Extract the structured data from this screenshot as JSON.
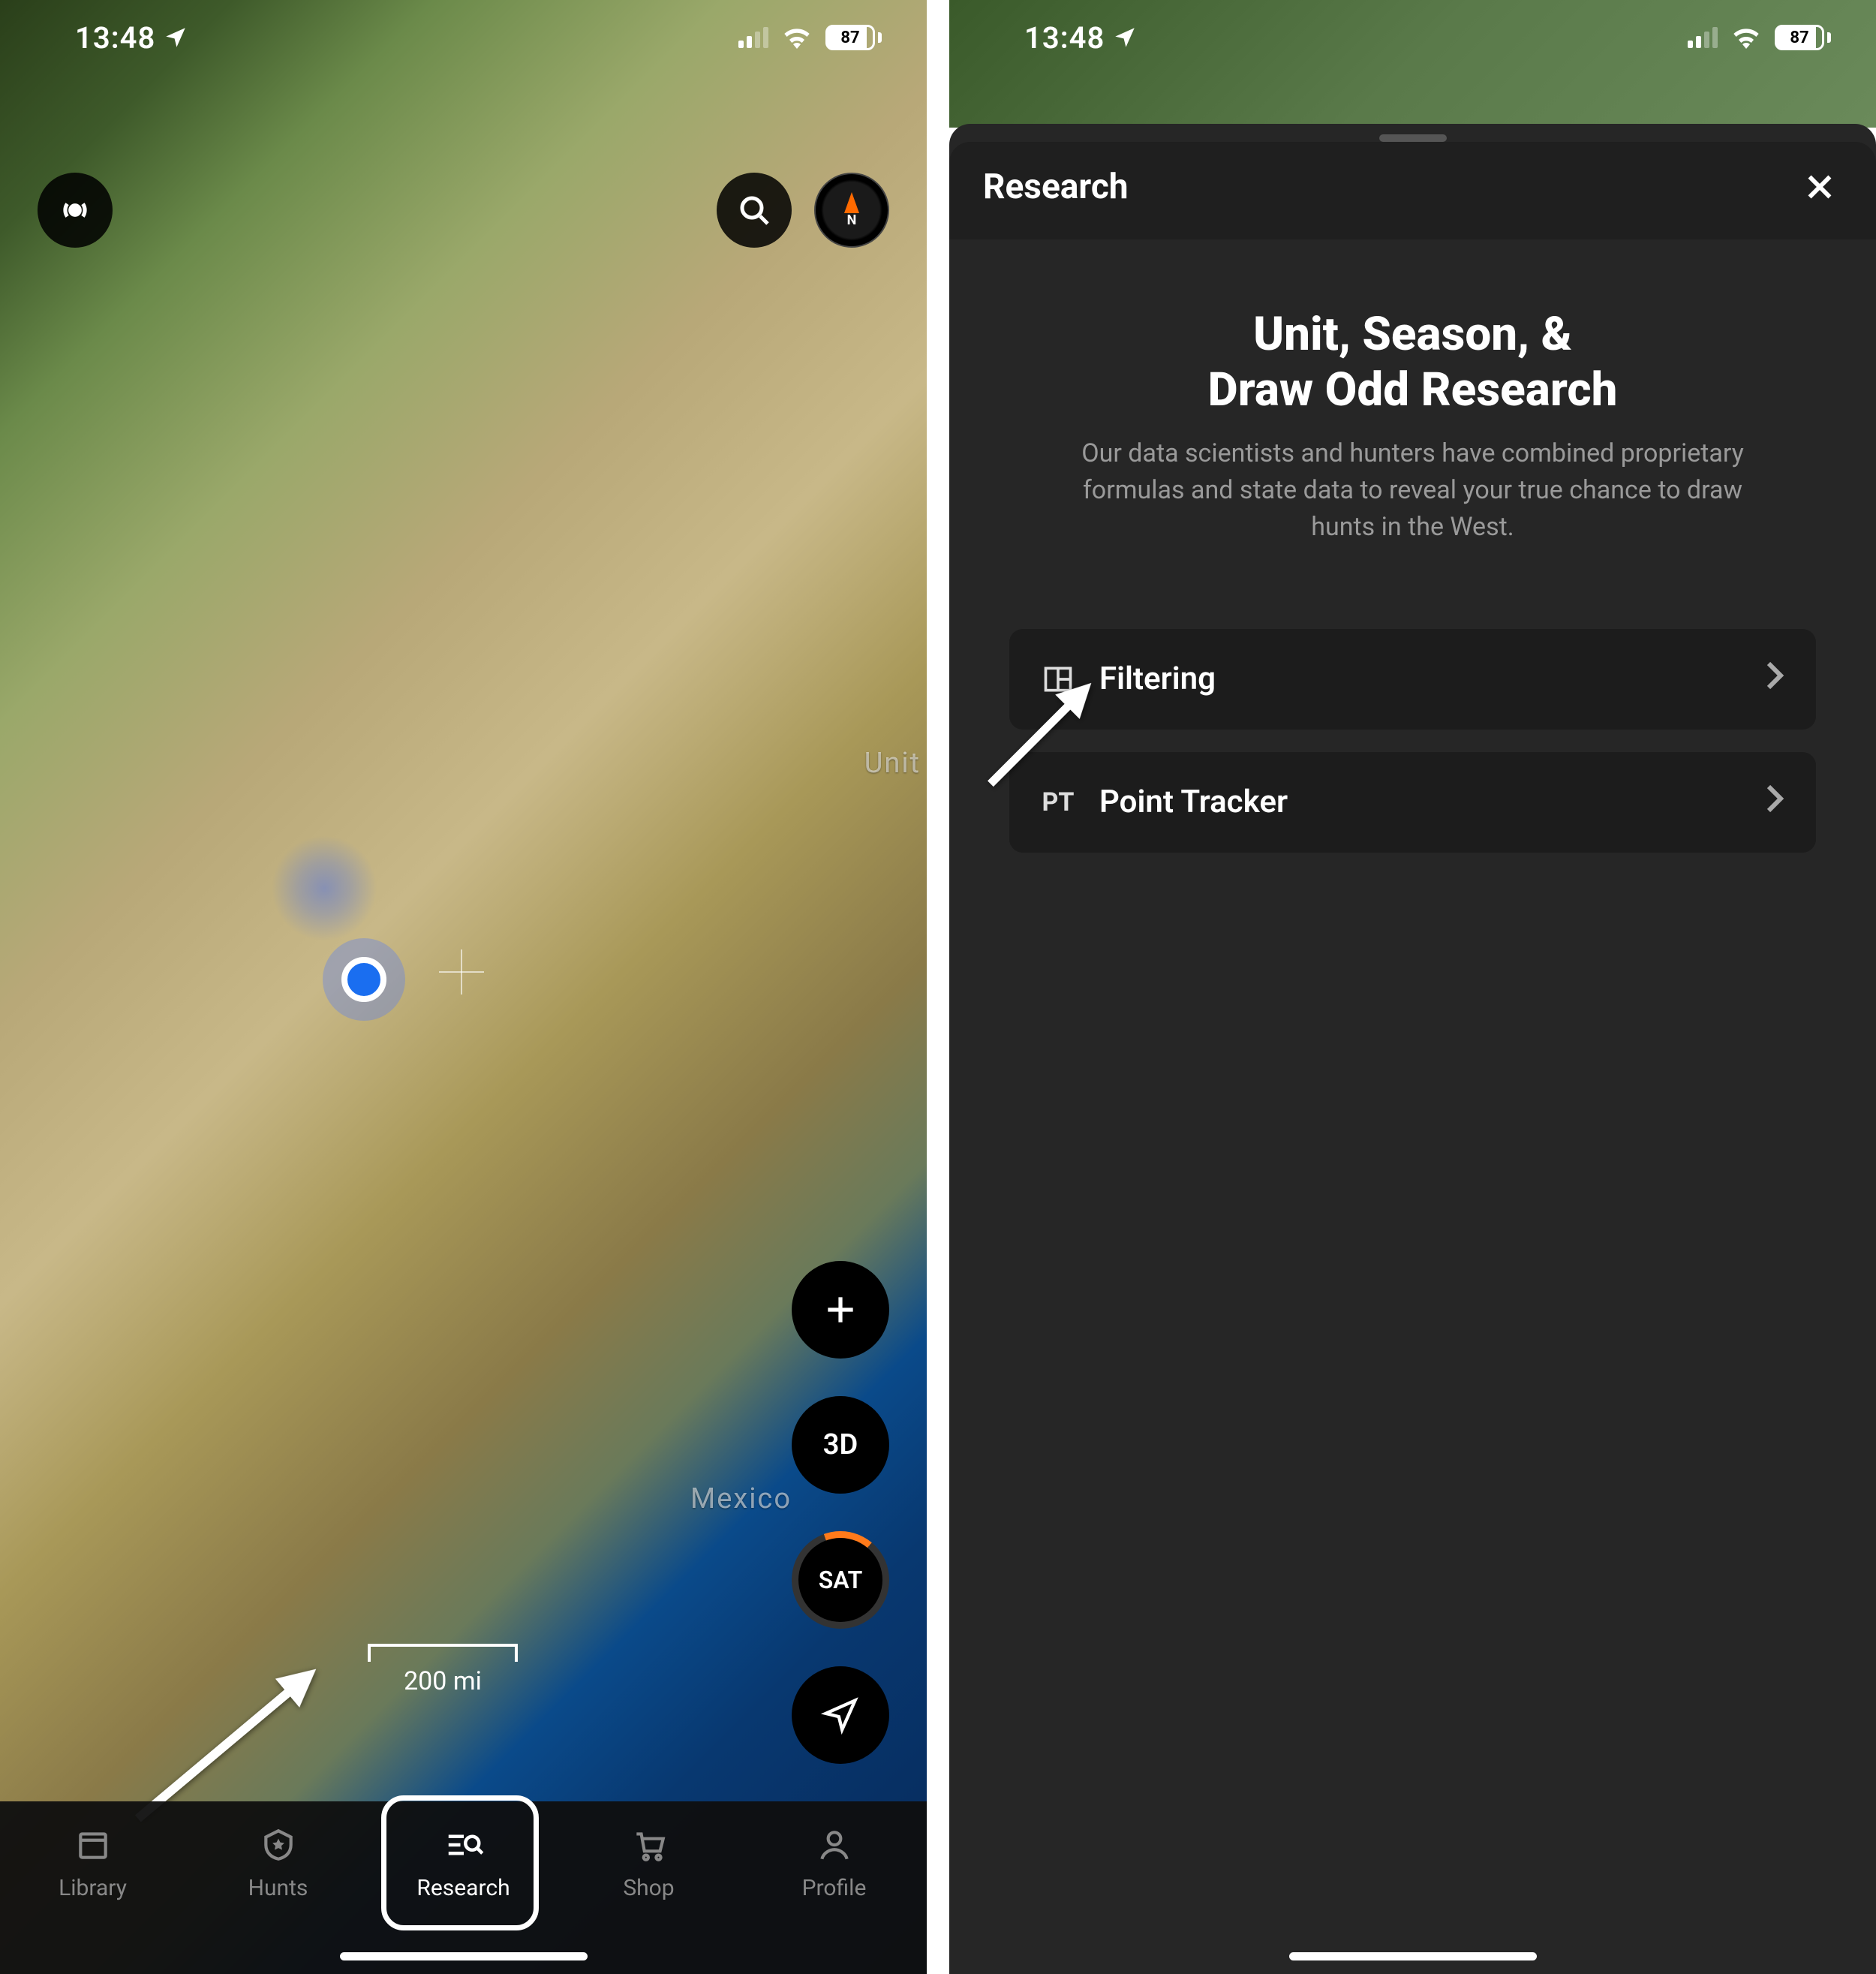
{
  "status": {
    "time": "13:48",
    "battery": "87"
  },
  "map": {
    "label_country1": "Unit",
    "label_country2": "Mexico",
    "scale_label": "200 mi",
    "btn_3d": "3D",
    "btn_sat": "SAT",
    "compass_letter": "N"
  },
  "tabs": {
    "library": "Library",
    "hunts": "Hunts",
    "research": "Research",
    "shop": "Shop",
    "profile": "Profile"
  },
  "research": {
    "header": "Research",
    "title": "Unit, Season, &\nDraw Odd Research",
    "subtitle": "Our data scientists and hunters have combined proprietary formulas and state data to reveal your true chance to draw hunts in the West.",
    "filtering_label": "Filtering",
    "pt_badge": "PT",
    "pt_label": "Point Tracker"
  }
}
